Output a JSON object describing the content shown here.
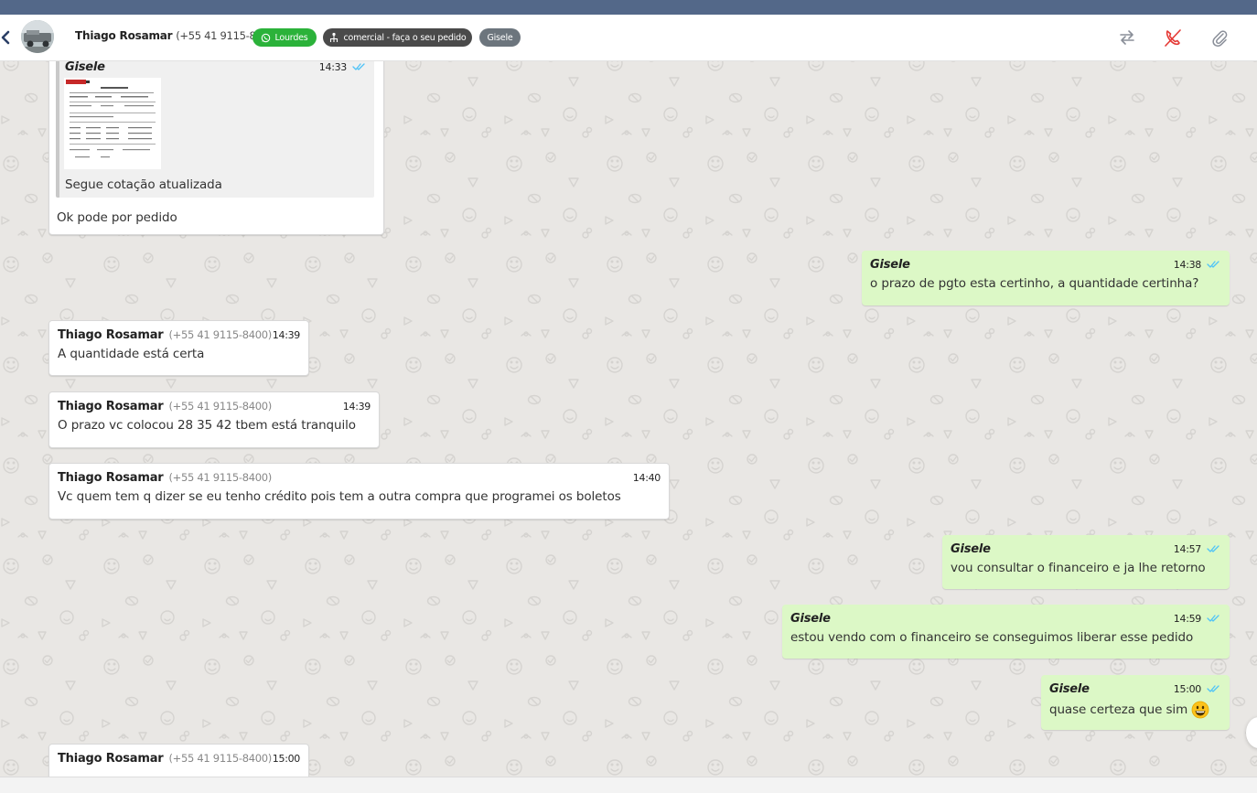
{
  "header": {
    "contact_name": "Thiago Rosamar",
    "contact_phone": "(+55 41 9115-8400)",
    "badge_whatsapp": "Lourdes",
    "badge_queue": "comercial - faça o seu pedido",
    "badge_user": "Gisele",
    "icons": [
      "chevron-left-icon",
      "avatar",
      "whatsapp-icon",
      "queue-icon",
      "transfer-icon",
      "end-call-icon",
      "paperclip-icon"
    ]
  },
  "colors": {
    "topbar": "#536889",
    "badge_green": "#2bb23a",
    "badge_dark": "#4a4a4a",
    "badge_gray": "#6c757d",
    "outgoing_bubble": "#dcf8c6",
    "incoming_bubble": "#ffffff",
    "read_check": "#4fc3f7",
    "end_call": "#e53935"
  },
  "messages": [
    {
      "id": "m1",
      "direction": "in",
      "quoted": {
        "sender": "Gisele",
        "time": "14:33",
        "caption": "Segue cotação atualizada"
      },
      "text": "Ok pode por pedido"
    },
    {
      "id": "m2",
      "direction": "out",
      "sender": "Gisele",
      "time": "14:38",
      "text": "o prazo de pgto esta certinho, a quantidade certinha?"
    },
    {
      "id": "m3",
      "direction": "in",
      "sender": "Thiago Rosamar",
      "phone": "(+55 41 9115-8400)",
      "time": "14:39",
      "text": "A quantidade está certa"
    },
    {
      "id": "m4",
      "direction": "in",
      "sender": "Thiago Rosamar",
      "phone": "(+55 41 9115-8400)",
      "time": "14:39",
      "text": "O prazo vc colocou 28 35 42 tbem está tranquilo"
    },
    {
      "id": "m5",
      "direction": "in",
      "sender": "Thiago Rosamar",
      "phone": "(+55 41 9115-8400)",
      "time": "14:40",
      "text": "Vc quem tem q dizer se eu tenho crédito pois tem a outra compra que programei os boletos"
    },
    {
      "id": "m6",
      "direction": "out",
      "sender": "Gisele",
      "time": "14:57",
      "text": "vou consultar o financeiro e ja lhe retorno"
    },
    {
      "id": "m7",
      "direction": "out",
      "sender": "Gisele",
      "time": "14:59",
      "text": "estou vendo com o financeiro se conseguimos liberar esse pedido"
    },
    {
      "id": "m8",
      "direction": "out",
      "sender": "Gisele",
      "time": "15:00",
      "text": "quase certeza que sim",
      "emoji": "😀"
    },
    {
      "id": "m9",
      "direction": "in",
      "sender": "Thiago Rosamar",
      "phone": "(+55 41 9115-8400)",
      "time": "15:00"
    }
  ]
}
